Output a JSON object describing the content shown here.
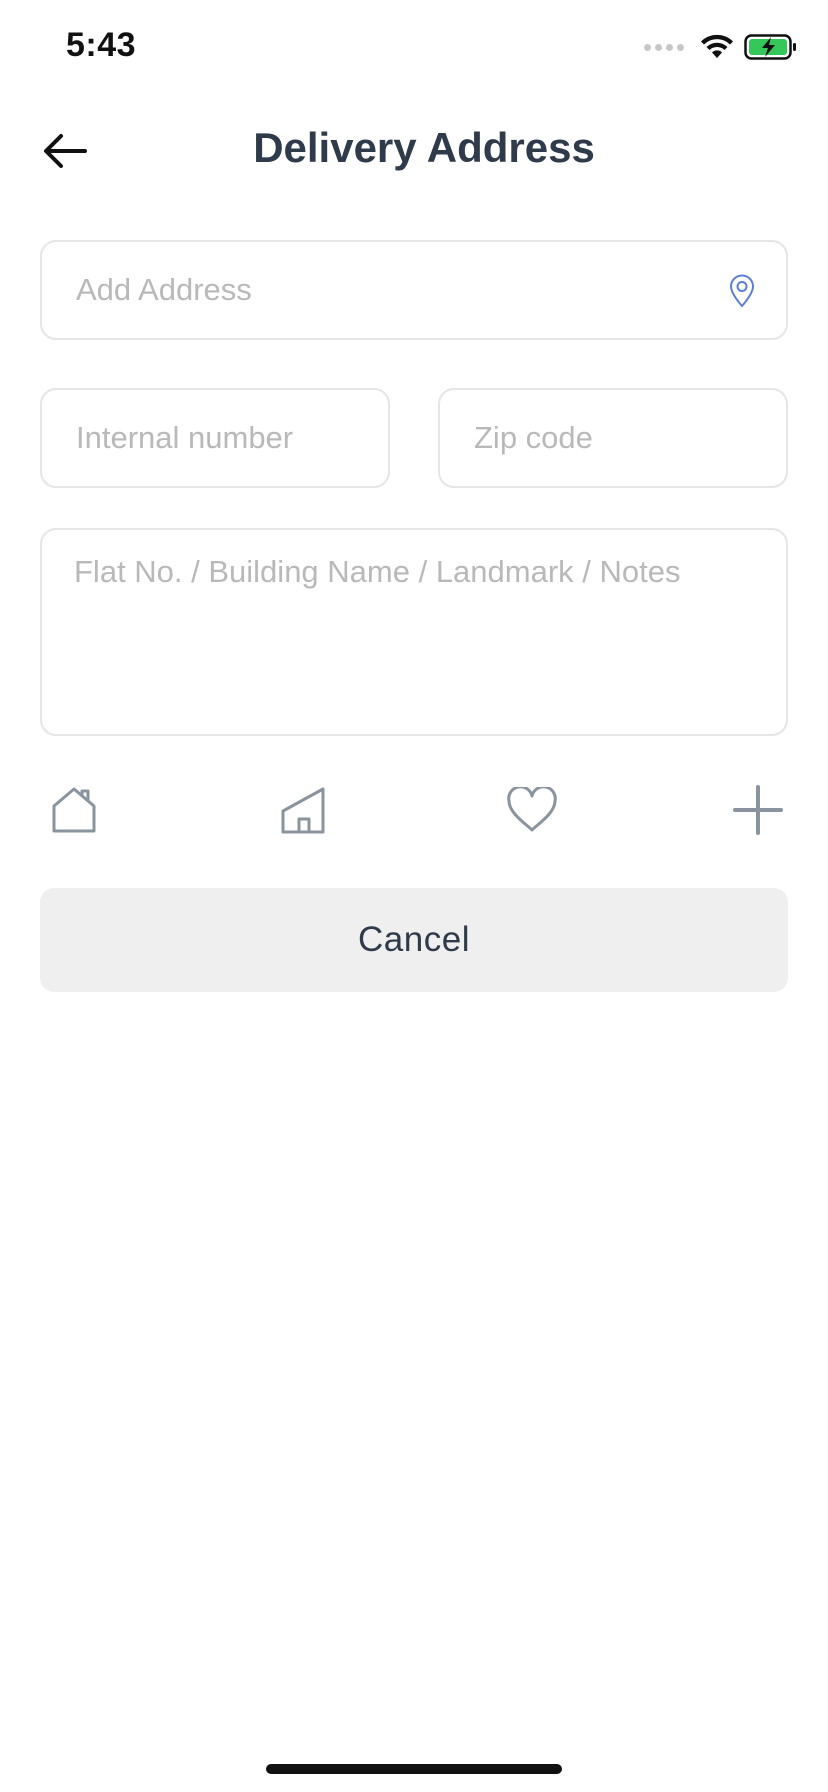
{
  "status_bar": {
    "time": "5:43",
    "icons": [
      "signal-icon",
      "wifi-icon",
      "battery-charging-icon"
    ],
    "battery_color": "#34c759"
  },
  "header": {
    "title": "Delivery Address",
    "back_icon": "arrow-left-icon"
  },
  "form": {
    "address": {
      "placeholder": "Add Address",
      "value": "",
      "icon": "location-pin-icon",
      "icon_color": "#5b7fd6"
    },
    "internal_number": {
      "placeholder": "Internal number",
      "value": ""
    },
    "zip_code": {
      "placeholder": "Zip code",
      "value": ""
    },
    "notes": {
      "placeholder": "Flat No. / Building Name / Landmark / Notes",
      "value": ""
    }
  },
  "address_types": [
    {
      "icon": "home-icon"
    },
    {
      "icon": "building-icon"
    },
    {
      "icon": "heart-icon"
    },
    {
      "icon": "plus-icon"
    }
  ],
  "actions": {
    "cancel_label": "Cancel"
  },
  "colors": {
    "title": "#2f3a4a",
    "icon_gray": "#8a949e",
    "border": "#e6e6e6",
    "button_bg": "#efefef",
    "placeholder": "#b9b9b9"
  }
}
